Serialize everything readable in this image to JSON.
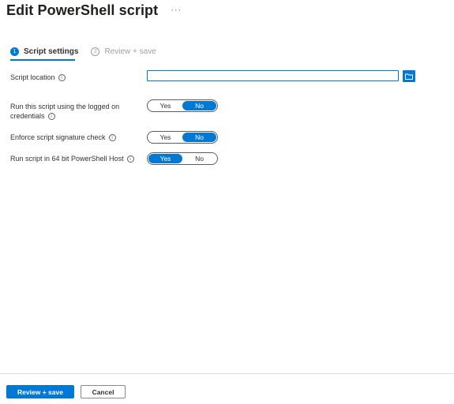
{
  "header": {
    "title": "Edit PowerShell script",
    "more_label": "···"
  },
  "steps": [
    {
      "number": "1",
      "label": "Script settings",
      "state": "active"
    },
    {
      "number": "2",
      "label": "Review + save",
      "state": "inactive"
    }
  ],
  "form": {
    "script_location": {
      "label": "Script location",
      "value": ""
    },
    "run_as_logged_on": {
      "label_line1": "Run this script using the logged on",
      "label_line2": "credentials",
      "options": [
        "Yes",
        "No"
      ],
      "selected": "No"
    },
    "signature_check": {
      "label": "Enforce script signature check",
      "options": [
        "Yes",
        "No"
      ],
      "selected": "No"
    },
    "run_64bit": {
      "label": "Run script in 64 bit PowerShell Host",
      "options": [
        "Yes",
        "No"
      ],
      "selected": "Yes"
    },
    "info_icon_glyph": "i"
  },
  "footer": {
    "primary_label": "Review + save",
    "secondary_label": "Cancel"
  },
  "colors": {
    "accent": "#0078d4",
    "text": "#323130",
    "muted": "#a19f9d"
  }
}
